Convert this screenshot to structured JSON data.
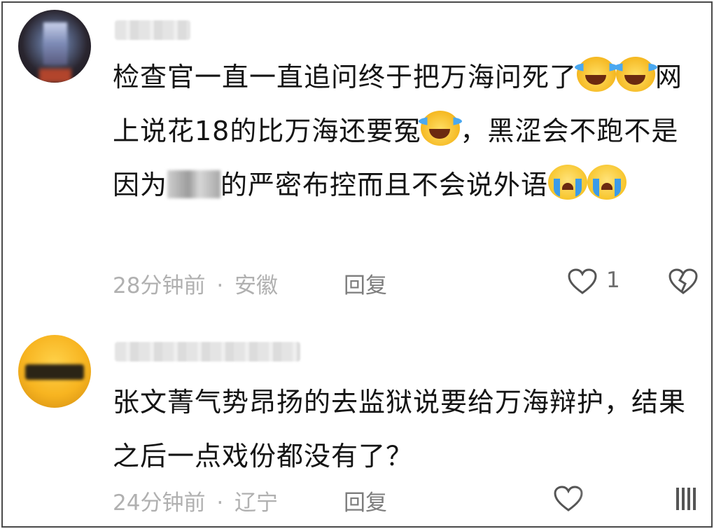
{
  "comments": [
    {
      "username": "",
      "text_parts": {
        "p1": "检查官一直一直追问终于把万海问死了",
        "p2": "网上说花18的比万海还要冤",
        "p3": "，黑涩会不跑不是因为",
        "p4": "的严密布控而且不会说外语"
      },
      "time": "28分钟前",
      "separator": "·",
      "location": "安徽",
      "reply_label": "回复",
      "like_count": "1"
    },
    {
      "username": "",
      "text": "张文菁气势昂扬的去监狱说要给万海辩护，结果之后一点戏份都没有了？",
      "time": "24分钟前",
      "separator": "·",
      "location": "辽宁",
      "reply_label": "回复"
    }
  ],
  "icons": {
    "emoji_1": "face-with-tears-of-joy",
    "emoji_2": "face-with-tears-of-joy",
    "emoji_3": "face-with-tears-of-joy",
    "emoji_4": "loudly-crying-face",
    "emoji_5": "loudly-crying-face",
    "like": "heart-outline-icon",
    "dislike": "broken-heart-icon"
  },
  "colors": {
    "text": "#141414",
    "meta": "#b0b0b0",
    "reply": "#7d7d7d",
    "icon": "#555555"
  }
}
